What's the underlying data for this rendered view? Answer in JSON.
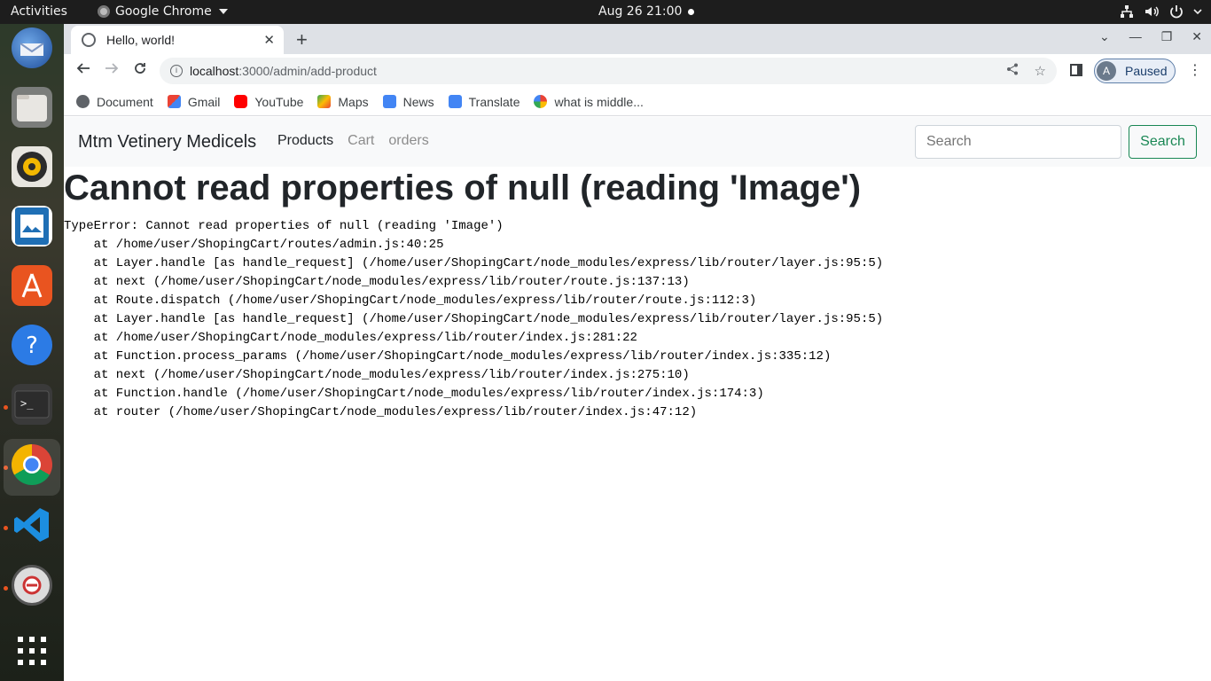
{
  "topbar": {
    "activities": "Activities",
    "app_name": "Google Chrome",
    "clock": "Aug 26  21:00"
  },
  "dock": {
    "items": [
      "thunderbird-icon",
      "files-icon",
      "rhythmbox-icon",
      "writer-icon",
      "app-center-icon",
      "help-icon",
      "terminal-icon",
      "chrome-icon",
      "vscode-icon",
      "updater-icon",
      "app-grid-icon"
    ]
  },
  "browser": {
    "tab_title": "Hello, world!",
    "url_host": "localhost",
    "url_path": ":3000/admin/add-product",
    "profile_initial": "A",
    "profile_label": "Paused",
    "bookmarks": [
      {
        "label": "Document",
        "color": "#5f6368"
      },
      {
        "label": "Gmail",
        "color": "#ea4335"
      },
      {
        "label": "YouTube",
        "color": "#ff0000"
      },
      {
        "label": "Maps",
        "color": "#34a853"
      },
      {
        "label": "News",
        "color": "#4285f4"
      },
      {
        "label": "Translate",
        "color": "#4285f4"
      },
      {
        "label": "what is middle...",
        "color": "#ea4335"
      }
    ]
  },
  "navbar": {
    "brand": "Mtm Vetinery Medicels",
    "links": [
      "Products",
      "Cart",
      "orders"
    ],
    "search_placeholder": "Search",
    "search_button": "Search"
  },
  "error": {
    "title": "Cannot read properties of null (reading 'Image')",
    "stack": [
      "TypeError: Cannot read properties of null (reading 'Image')",
      "    at /home/user/ShopingCart/routes/admin.js:40:25",
      "    at Layer.handle [as handle_request] (/home/user/ShopingCart/node_modules/express/lib/router/layer.js:95:5)",
      "    at next (/home/user/ShopingCart/node_modules/express/lib/router/route.js:137:13)",
      "    at Route.dispatch (/home/user/ShopingCart/node_modules/express/lib/router/route.js:112:3)",
      "    at Layer.handle [as handle_request] (/home/user/ShopingCart/node_modules/express/lib/router/layer.js:95:5)",
      "    at /home/user/ShopingCart/node_modules/express/lib/router/index.js:281:22",
      "    at Function.process_params (/home/user/ShopingCart/node_modules/express/lib/router/index.js:335:12)",
      "    at next (/home/user/ShopingCart/node_modules/express/lib/router/index.js:275:10)",
      "    at Function.handle (/home/user/ShopingCart/node_modules/express/lib/router/index.js:174:3)",
      "    at router (/home/user/ShopingCart/node_modules/express/lib/router/index.js:47:12)"
    ]
  }
}
